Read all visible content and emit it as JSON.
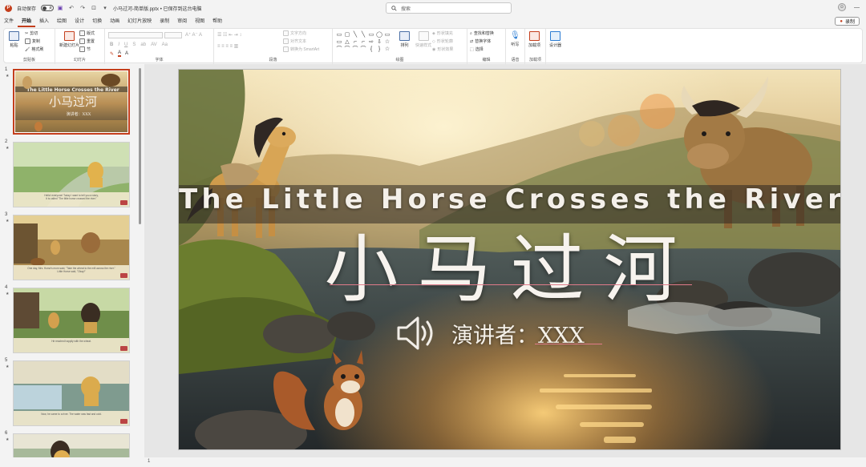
{
  "titlebar": {
    "autosave_label": "自动保存",
    "autosave_state": "关",
    "document_title": "小马过河-简单版.pptx • 已保存到这台电脑",
    "search_placeholder": "搜索"
  },
  "menu": {
    "tabs": [
      "文件",
      "开始",
      "插入",
      "绘图",
      "设计",
      "切换",
      "动画",
      "幻灯片放映",
      "录制",
      "审阅",
      "视图",
      "帮助"
    ],
    "active_tab": "开始",
    "share_label": "录制"
  },
  "ribbon": {
    "clipboard": {
      "paste": "粘贴",
      "cut": "剪切",
      "copy": "复制",
      "format_painter": "格式刷",
      "label": "剪贴板"
    },
    "slides": {
      "new_slide": "新建幻灯片",
      "layout": "版式",
      "reset": "重置",
      "section": "节",
      "label": "幻灯片"
    },
    "font": {
      "label": "字体"
    },
    "paragraph": {
      "text_direction": "文字方向",
      "align_text": "对齐文本",
      "smartart": "转换为 SmartArt",
      "label": "段落"
    },
    "drawing": {
      "arrange": "排列",
      "quick_styles": "快速样式",
      "shape_fill": "形状填充",
      "shape_outline": "形状轮廓",
      "shape_effects": "形状效果",
      "label": "绘图"
    },
    "editing": {
      "find": "查找和替换",
      "replace": "替换字体",
      "select": "选择",
      "label": "编辑"
    },
    "voice": {
      "dictate": "听写",
      "label": "语音"
    },
    "addins": {
      "addins": "加载项",
      "label": "加载项"
    },
    "designer": {
      "label": "设计器"
    }
  },
  "thumbnails": [
    {
      "num": "1",
      "en": "The Little Horse Crosses the River",
      "cn": "小马过河",
      "speaker": "演讲者：XXX"
    },
    {
      "num": "2",
      "caption_en": "Hello! everyone! Today I want to tell you a story,",
      "caption_en2": "It is called \"The little horse crossed the river.\""
    },
    {
      "num": "3",
      "caption_en": "One day, Mrs. Horse's mom said, \"Take the wheat to the mill across the river.\"",
      "caption_en2": "Little Horse said, \"Okay!\""
    },
    {
      "num": "4",
      "caption_en": "He reached happily with the wheat.",
      "caption_en2": ""
    },
    {
      "num": "5",
      "caption_en": "Now, he came to a river. The water was fast and cold.",
      "caption_en2": ""
    },
    {
      "num": "6",
      "caption_en": "",
      "caption_en2": ""
    }
  ],
  "slide": {
    "title_en": "The Little Horse Crosses the River",
    "title_cn": "小马过河",
    "speaker": "演讲者：XXX"
  },
  "status": {
    "slide_number": "1"
  }
}
